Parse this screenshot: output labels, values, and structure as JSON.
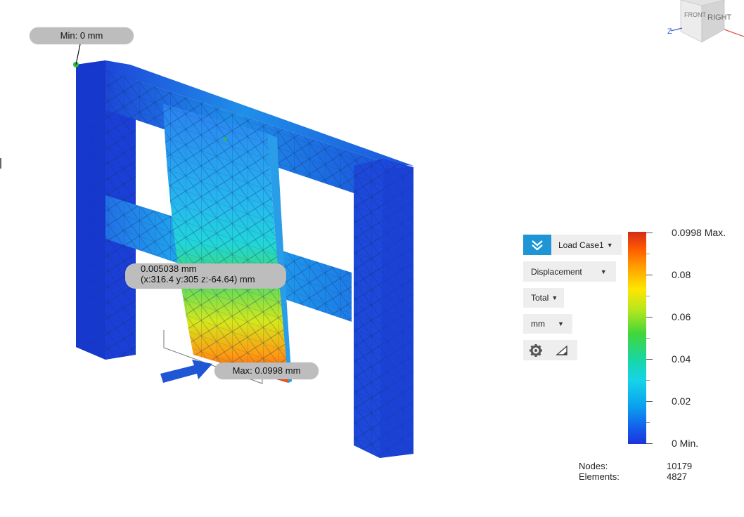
{
  "callouts": {
    "min": "Min: 0 mm",
    "probe_value": "0.005038 mm",
    "probe_coords": "(x:316.4 y:305 z:-64.64) mm",
    "max": "Max: 0.0998 mm"
  },
  "viewcube": {
    "front": "FRONT",
    "right": "RIGHT",
    "axis_z": "Z"
  },
  "panel": {
    "load_case": "Load Case1",
    "result_type": "Displacement",
    "component": "Total",
    "unit": "mm"
  },
  "legend": {
    "max_label": "0.0998 Max.",
    "labels": [
      "0.08",
      "0.06",
      "0.04",
      "0.02"
    ],
    "min_label": "0 Min."
  },
  "mesh_stats": {
    "nodes_label": "Nodes:",
    "nodes_value": "10179",
    "elements_label": "Elements:",
    "elements_value": "4827"
  },
  "colors": {
    "accent": "#1e96d6",
    "legend_max": "#d42b1b",
    "legend_min": "#1b33dd",
    "callout_bg": "#bdbdbd"
  }
}
